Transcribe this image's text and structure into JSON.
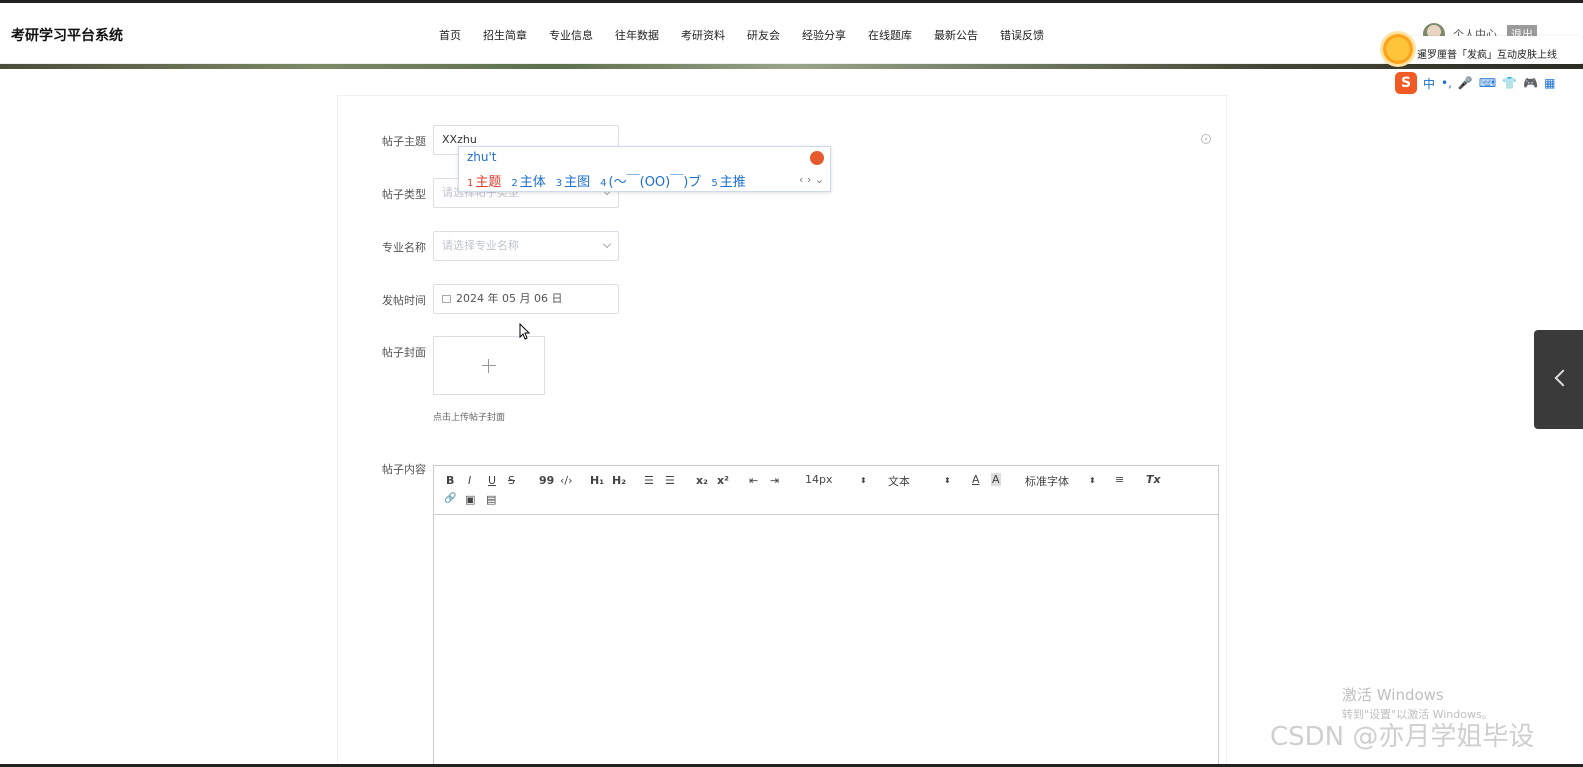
{
  "header": {
    "brand": "考研学习平台系统",
    "nav": [
      "首页",
      "招生简章",
      "专业信息",
      "往年数据",
      "考研资料",
      "研友会",
      "经验分享",
      "在线题库",
      "最新公告",
      "错误反馈"
    ],
    "user_center": "个人中心",
    "logout": "退出"
  },
  "ime_notice": "暹罗厘普「发疯」互动皮肤上线",
  "ime_toolbar": [
    "中",
    "•,",
    "🎤",
    "⌨",
    "👕",
    "🎮",
    "▦"
  ],
  "form": {
    "topic_label": "帖子主题",
    "topic_value": "XXzhu",
    "type_label": "帖子类型",
    "type_placeholder": "请选择帖子类型",
    "major_label": "专业名称",
    "major_placeholder": "请选择专业名称",
    "time_label": "发帖时间",
    "time_value": "2024 年 05 月 06 日",
    "cover_label": "帖子封面",
    "cover_hint": "点击上传帖子封面",
    "content_label": "帖子内容"
  },
  "editor_toolbar": {
    "bold": "B",
    "italic": "I",
    "underline": "U",
    "strike": "S",
    "quote": "99",
    "code": "‹/›",
    "h1": "H₁",
    "h2": "H₂",
    "ol": "☰",
    "ul": "☰",
    "sub": "x₂",
    "sup": "x²",
    "outdent": "⇤",
    "indent": "⇥",
    "size": "14px",
    "header": "文本",
    "color": "A",
    "background": "A",
    "font": "标准字体",
    "align": "≡",
    "clean": "Tx",
    "link": "🔗",
    "image": "▣",
    "video": "▤"
  },
  "ime_popup": {
    "pinyin": "zhu't",
    "candidates": [
      {
        "num": "1",
        "text": "主题"
      },
      {
        "num": "2",
        "text": "主体"
      },
      {
        "num": "3",
        "text": "主图"
      },
      {
        "num": "4",
        "text": "(～￣(OO)￣)ブ"
      },
      {
        "num": "5",
        "text": "主推"
      }
    ],
    "arrows": "‹ › ⌄"
  },
  "watermarks": {
    "windows_title": "激活 Windows",
    "windows_sub": "转到\"设置\"以激活 Windows。",
    "csdn": "CSDN @亦月学姐毕设"
  }
}
